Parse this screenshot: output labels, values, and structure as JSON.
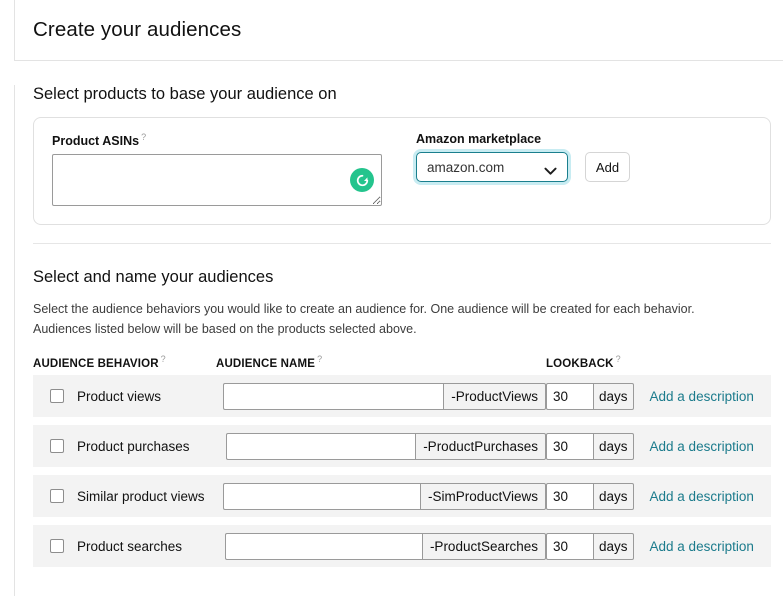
{
  "header": {
    "title": "Create your audiences"
  },
  "products_section": {
    "heading": "Select products to base your audience on",
    "asin_label": "Product ASINs",
    "asin_help": "?",
    "asin_value": "",
    "asin_placeholder": "",
    "spinner_icon": "refresh-icon",
    "spinner_color": "#24c48d",
    "marketplace_label": "Amazon marketplace",
    "marketplace_selected": "amazon.com",
    "marketplace_options": [
      "amazon.com"
    ],
    "marketplace_focus_color": "#1a7f8e",
    "add_button": "Add"
  },
  "audiences_section": {
    "heading": "Select and name your audiences",
    "description": "Select the audience behaviors you would like to create an audience for. One audience will be created for each behavior. Audiences listed below will be based on the products selected above.",
    "columns": [
      {
        "label": "AUDIENCE BEHAVIOR",
        "help": "?"
      },
      {
        "label": "AUDIENCE NAME",
        "help": "?"
      },
      {
        "label": "LOOKBACK",
        "help": "?"
      }
    ],
    "link_color": "#1b7b8c",
    "rows": [
      {
        "behavior": "Product views",
        "checked": false,
        "name_value": "",
        "name_suffix": "-ProductViews",
        "lookback_value": "30",
        "lookback_unit": "days",
        "description_link": "Add a description"
      },
      {
        "behavior": "Product purchases",
        "checked": false,
        "name_value": "",
        "name_suffix": "-ProductPurchases",
        "lookback_value": "30",
        "lookback_unit": "days",
        "description_link": "Add a description"
      },
      {
        "behavior": "Similar product views",
        "checked": false,
        "name_value": "",
        "name_suffix": "-SimProductViews",
        "lookback_value": "30",
        "lookback_unit": "days",
        "description_link": "Add a description"
      },
      {
        "behavior": "Product searches",
        "checked": false,
        "name_value": "",
        "name_suffix": "-ProductSearches",
        "lookback_value": "30",
        "lookback_unit": "days",
        "description_link": "Add a description"
      }
    ]
  }
}
